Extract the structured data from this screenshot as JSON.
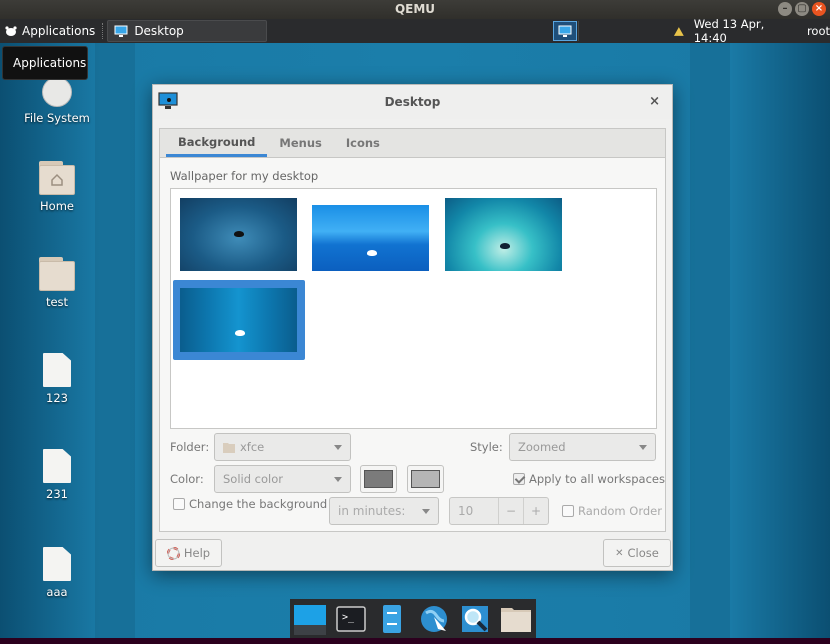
{
  "qemu": {
    "title": "QEMU"
  },
  "panel": {
    "applications_label": "Applications",
    "task_label": "Desktop",
    "clock": "Wed 13 Apr, 14:40",
    "user": "root"
  },
  "tooltip": {
    "text": "Applications"
  },
  "desktop_icons": [
    {
      "label": "File System",
      "icon": "drive-icon"
    },
    {
      "label": "Home",
      "icon": "home-folder-icon"
    },
    {
      "label": "test",
      "icon": "folder-icon"
    },
    {
      "label": "123",
      "icon": "file-icon"
    },
    {
      "label": "231",
      "icon": "file-icon"
    },
    {
      "label": "aaa",
      "icon": "file-icon"
    }
  ],
  "dialog": {
    "title": "Desktop",
    "tabs": [
      "Background",
      "Menus",
      "Icons"
    ],
    "active_tab": "Background",
    "wallpaper_label": "Wallpaper for my desktop",
    "folder_label": "Folder:",
    "folder_value": "xfce",
    "style_label": "Style:",
    "style_value": "Zoomed",
    "color_label": "Color:",
    "color_value": "Solid color",
    "apply_all_label": "Apply to all workspaces",
    "apply_all_checked": true,
    "change_bg_label": "Change the background",
    "change_bg_checked": false,
    "interval_unit": "in minutes:",
    "interval_value": "10",
    "spin_minus": "−",
    "spin_plus": "+",
    "random_order_label": "Random Order",
    "random_order_checked": false,
    "help_label": "Help",
    "close_label": "Close",
    "close_glyph": "✕",
    "close_x": "×",
    "selected_wallpaper_index": 3
  },
  "colors": {
    "accent": "#3b87d4",
    "color1": "#7b7b7b",
    "color2": "#b5b5b5"
  },
  "dock": {
    "items": [
      "show-desktop-icon",
      "terminal-icon",
      "file-manager-icon",
      "web-browser-icon",
      "app-finder-icon",
      "folder-icon"
    ]
  }
}
